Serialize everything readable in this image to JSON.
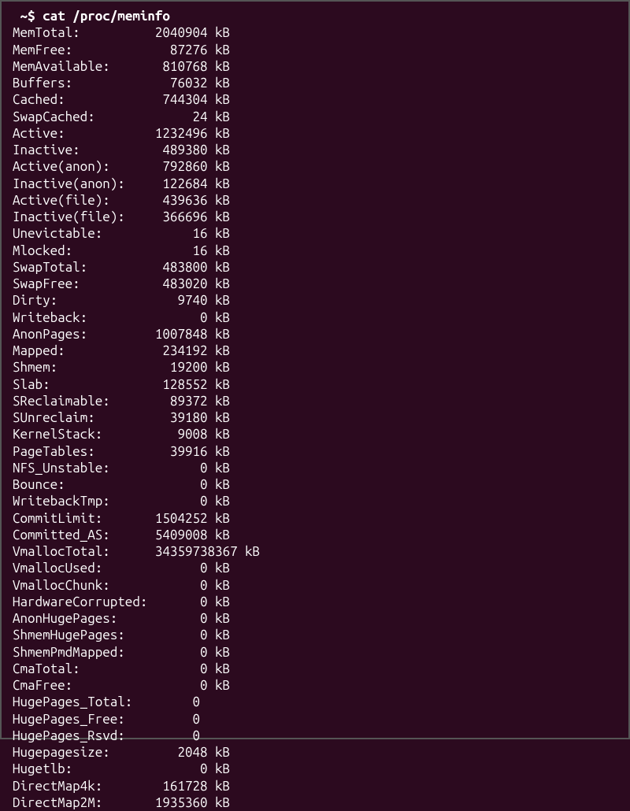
{
  "prompt": " ~$ ",
  "command": "cat /proc/meminfo",
  "entries": [
    {
      "name": "MemTotal",
      "value": 2040904,
      "unit": "kB"
    },
    {
      "name": "MemFree",
      "value": 87276,
      "unit": "kB"
    },
    {
      "name": "MemAvailable",
      "value": 810768,
      "unit": "kB"
    },
    {
      "name": "Buffers",
      "value": 76032,
      "unit": "kB"
    },
    {
      "name": "Cached",
      "value": 744304,
      "unit": "kB"
    },
    {
      "name": "SwapCached",
      "value": 24,
      "unit": "kB"
    },
    {
      "name": "Active",
      "value": 1232496,
      "unit": "kB"
    },
    {
      "name": "Inactive",
      "value": 489380,
      "unit": "kB"
    },
    {
      "name": "Active(anon)",
      "value": 792860,
      "unit": "kB"
    },
    {
      "name": "Inactive(anon)",
      "value": 122684,
      "unit": "kB"
    },
    {
      "name": "Active(file)",
      "value": 439636,
      "unit": "kB"
    },
    {
      "name": "Inactive(file)",
      "value": 366696,
      "unit": "kB"
    },
    {
      "name": "Unevictable",
      "value": 16,
      "unit": "kB"
    },
    {
      "name": "Mlocked",
      "value": 16,
      "unit": "kB"
    },
    {
      "name": "SwapTotal",
      "value": 483800,
      "unit": "kB"
    },
    {
      "name": "SwapFree",
      "value": 483020,
      "unit": "kB"
    },
    {
      "name": "Dirty",
      "value": 9740,
      "unit": "kB"
    },
    {
      "name": "Writeback",
      "value": 0,
      "unit": "kB"
    },
    {
      "name": "AnonPages",
      "value": 1007848,
      "unit": "kB"
    },
    {
      "name": "Mapped",
      "value": 234192,
      "unit": "kB"
    },
    {
      "name": "Shmem",
      "value": 19200,
      "unit": "kB"
    },
    {
      "name": "Slab",
      "value": 128552,
      "unit": "kB"
    },
    {
      "name": "SReclaimable",
      "value": 89372,
      "unit": "kB"
    },
    {
      "name": "SUnreclaim",
      "value": 39180,
      "unit": "kB"
    },
    {
      "name": "KernelStack",
      "value": 9008,
      "unit": "kB"
    },
    {
      "name": "PageTables",
      "value": 39916,
      "unit": "kB"
    },
    {
      "name": "NFS_Unstable",
      "value": 0,
      "unit": "kB"
    },
    {
      "name": "Bounce",
      "value": 0,
      "unit": "kB"
    },
    {
      "name": "WritebackTmp",
      "value": 0,
      "unit": "kB"
    },
    {
      "name": "CommitLimit",
      "value": 1504252,
      "unit": "kB"
    },
    {
      "name": "Committed_AS",
      "value": 5409008,
      "unit": "kB"
    },
    {
      "name": "VmallocTotal",
      "value": 34359738367,
      "unit": "kB"
    },
    {
      "name": "VmallocUsed",
      "value": 0,
      "unit": "kB"
    },
    {
      "name": "VmallocChunk",
      "value": 0,
      "unit": "kB"
    },
    {
      "name": "HardwareCorrupted",
      "value": 0,
      "unit": "kB"
    },
    {
      "name": "AnonHugePages",
      "value": 0,
      "unit": "kB"
    },
    {
      "name": "ShmemHugePages",
      "value": 0,
      "unit": "kB"
    },
    {
      "name": "ShmemPmdMapped",
      "value": 0,
      "unit": "kB"
    },
    {
      "name": "CmaTotal",
      "value": 0,
      "unit": "kB"
    },
    {
      "name": "CmaFree",
      "value": 0,
      "unit": "kB"
    },
    {
      "name": "HugePages_Total",
      "value": 0,
      "unit": ""
    },
    {
      "name": "HugePages_Free",
      "value": 0,
      "unit": ""
    },
    {
      "name": "HugePages_Rsvd",
      "value": 0,
      "unit": ""
    },
    {
      "name": "Hugepagesize",
      "value": 2048,
      "unit": "kB"
    },
    {
      "name": "Hugetlb",
      "value": 0,
      "unit": "kB"
    },
    {
      "name": "DirectMap4k",
      "value": 161728,
      "unit": "kB"
    },
    {
      "name": "DirectMap2M",
      "value": 1935360,
      "unit": "kB"
    }
  ],
  "label_col_width_chars": 18,
  "value_col_width_chars": 8,
  "long_value_col_width_chars": 12
}
